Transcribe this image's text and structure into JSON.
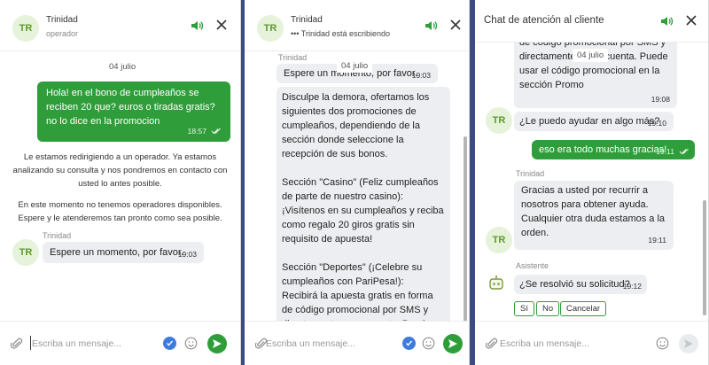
{
  "colors": {
    "accent": "#2f9e3a",
    "incoming_bubble": "#eceef1",
    "avatar_bg": "#e6f2d9",
    "check_blue": "#3d7bde"
  },
  "panel1": {
    "header": {
      "avatar": "TR",
      "name": "Trinidad",
      "status": "operador"
    },
    "date": "04 julio",
    "outgoing": {
      "text": "Hola! en el bono de cumpleaños se reciben 20 que? euros o tiradas gratis? no lo dice en la promocion",
      "time": "18:57"
    },
    "system_1": "Le estamos redirigiendo a un operador. Ya estamos analizando su consulta y nos pondremos en contacto con usted lo antes posible.",
    "system_2": "En este momento no tenemos operadores disponibles. Espere y le atenderemos tan pronto como sea posible.",
    "reply_sender": "Trinidad",
    "reply": {
      "avatar": "TR",
      "text": "Espere un momento, por favor.",
      "time": "19:03"
    },
    "composer": {
      "placeholder": "Escriba un mensaje..."
    }
  },
  "panel2": {
    "header": {
      "avatar": "TR",
      "name": "Trinidad",
      "status": "••• Trinidad está escribiendo"
    },
    "top_sender": "Trinidad",
    "date": "04 julio",
    "msg1": {
      "text": "Espere un momento, por favor.",
      "time": "19:03"
    },
    "msg2": {
      "text": "Disculpe la demora, ofertamos los siguientes dos promociones de cumpleaños, dependiendo de la sección donde seleccione la recepción de sus bonos.\n\nSección \"Casino\" (Feliz cumpleaños de parte de nuestro casino):\n¡Visítenos en su cumpleaños y reciba como regalo 20 giros gratis sin requisito de apuesta!\n\nSección \"Deportes\" (¡Celebre su cumpleaños con PariPesa!):\nRecibirá la apuesta gratis en forma de código promocional por SMS y directamente en su cuenta. Puede"
    },
    "composer": {
      "placeholder": "Escriba un mensaje..."
    }
  },
  "panel3": {
    "header": {
      "title": "Chat de atención al cliente"
    },
    "date": "04 julio",
    "msg_top": {
      "text": "de código promocional por SMS y directamente en su cuenta. Puede usar el código promocional en la sección Promo",
      "time": "19:08"
    },
    "msg_help": {
      "avatar": "TR",
      "text": "¿Le puedo ayudar en algo más?",
      "time": "19:10"
    },
    "msg_user": {
      "text": "eso era todo muchas gracias!",
      "time": "19:11"
    },
    "sender_trinidad": "Trinidad",
    "msg_thanks": {
      "avatar": "TR",
      "text": "Gracias a usted por recurrir a nosotros para obtener ayuda. Cualquier otra duda estamos a la orden.",
      "time": "19:11"
    },
    "sender_bot": "Asistente",
    "msg_bot": {
      "text": "¿Se resolvió su solicitud?",
      "time": "19:12"
    },
    "answers": [
      "Sí",
      "No",
      "Cancelar"
    ],
    "composer": {
      "placeholder": "Escriba un mensaje..."
    }
  }
}
